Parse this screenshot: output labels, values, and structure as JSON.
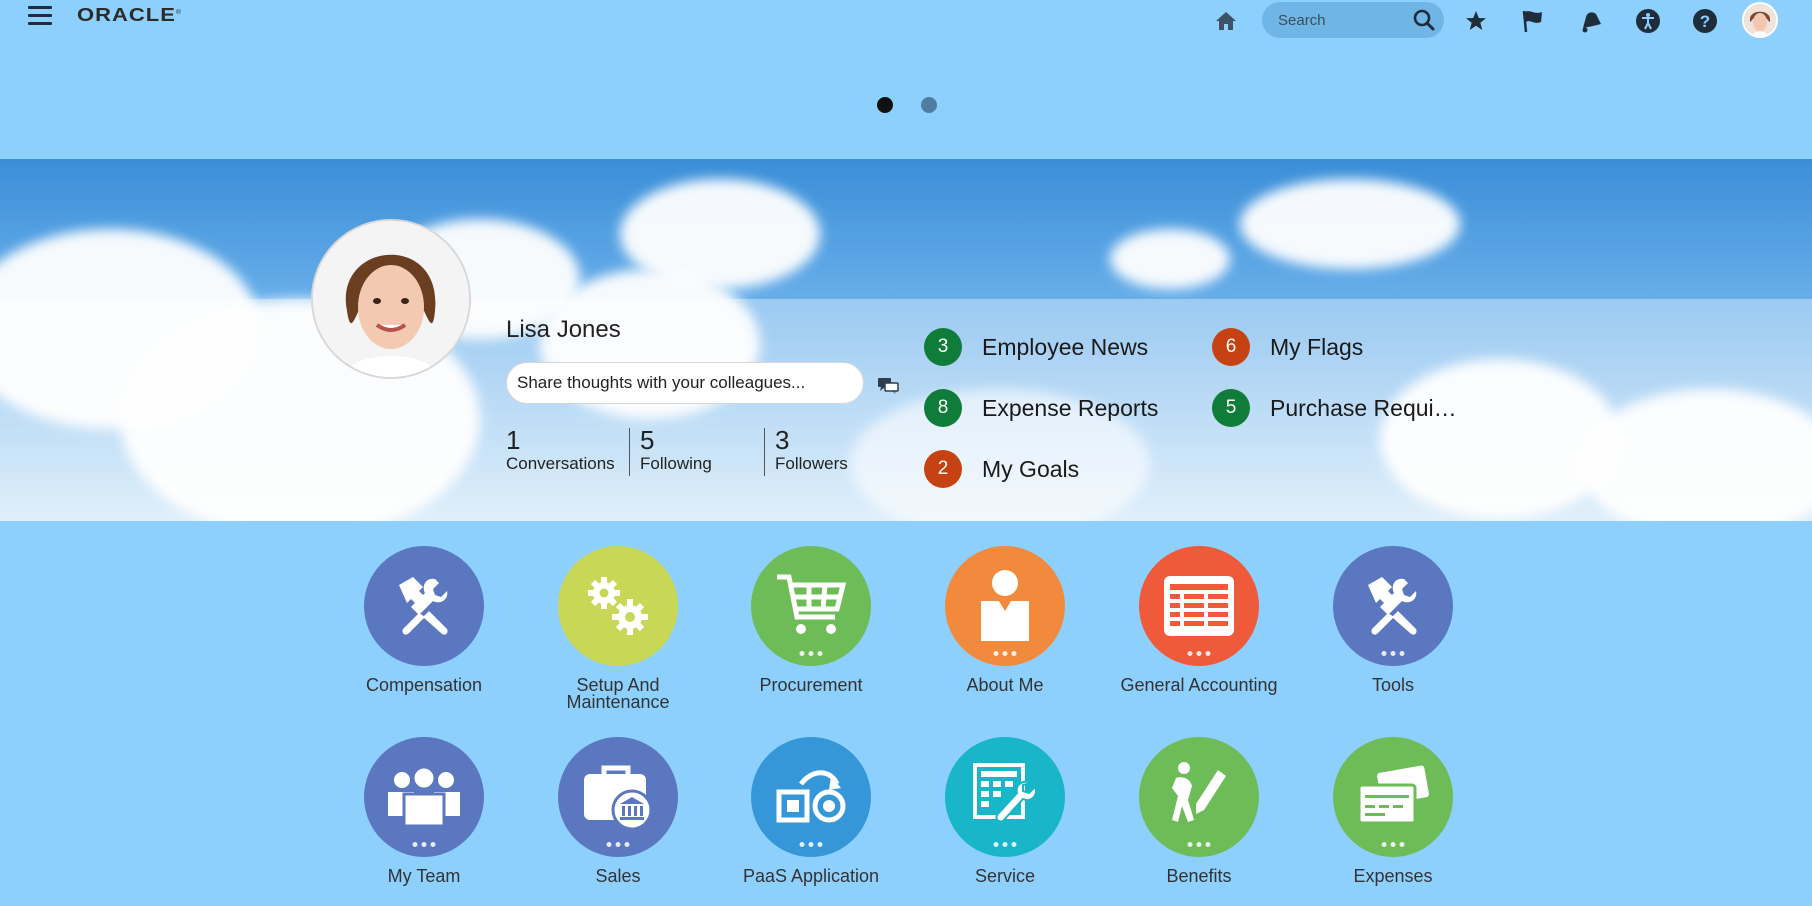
{
  "header": {
    "logo_text": "ORACLE",
    "search_placeholder": "Search",
    "icons": [
      "menu-icon",
      "home-icon",
      "search-icon",
      "favorites-star-icon",
      "flag-icon",
      "notifications-bell-icon",
      "accessibility-icon",
      "help-icon",
      "user-avatar"
    ]
  },
  "carousel": {
    "page_count": 2,
    "active_page": 1
  },
  "profile": {
    "name": "Lisa Jones",
    "share_placeholder": "Share thoughts with your colleagues...",
    "stats": [
      {
        "value": "1",
        "label": "Conversations"
      },
      {
        "value": "5",
        "label": "Following"
      },
      {
        "value": "3",
        "label": "Followers"
      }
    ]
  },
  "notifications": [
    {
      "count": "3",
      "label": "Employee News",
      "color": "#0f7c3a"
    },
    {
      "count": "6",
      "label": "My Flags",
      "color": "#c74212"
    },
    {
      "count": "8",
      "label": "Expense Reports",
      "color": "#0f7c3a"
    },
    {
      "count": "5",
      "label": "Purchase Requi…",
      "color": "#0f7c3a"
    },
    {
      "count": "2",
      "label": "My Goals",
      "color": "#c74212"
    }
  ],
  "apps": [
    {
      "label": "Compensation",
      "icon": "tools-icon",
      "color": "#5a77c0",
      "has_more": false
    },
    {
      "label": "Setup And\nMaintenance",
      "icon": "gears-icon",
      "color": "#c8d756",
      "has_more": false
    },
    {
      "label": "Procurement",
      "icon": "shopping-cart-icon",
      "color": "#6dbc57",
      "has_more": true
    },
    {
      "label": "About Me",
      "icon": "person-icon",
      "color": "#f28a3d",
      "has_more": true
    },
    {
      "label": "General Accounting",
      "icon": "ledger-icon",
      "color": "#ef5a3a",
      "has_more": true
    },
    {
      "label": "Tools",
      "icon": "tools-icon",
      "color": "#5a77c0",
      "has_more": true
    },
    {
      "label": "My Team",
      "icon": "team-icon",
      "color": "#5a77c0",
      "has_more": true
    },
    {
      "label": "Sales",
      "icon": "briefcase-bank-icon",
      "color": "#5a77c0",
      "has_more": true
    },
    {
      "label": "PaaS Application",
      "icon": "paas-icon",
      "color": "#3597d8",
      "has_more": true
    },
    {
      "label": "Service",
      "icon": "service-icon",
      "color": "#19b5c9",
      "has_more": true
    },
    {
      "label": "Benefits",
      "icon": "benefits-icon",
      "color": "#6dbc57",
      "has_more": true
    },
    {
      "label": "Expenses",
      "icon": "credit-card-icon",
      "color": "#6dbc57",
      "has_more": true
    }
  ]
}
